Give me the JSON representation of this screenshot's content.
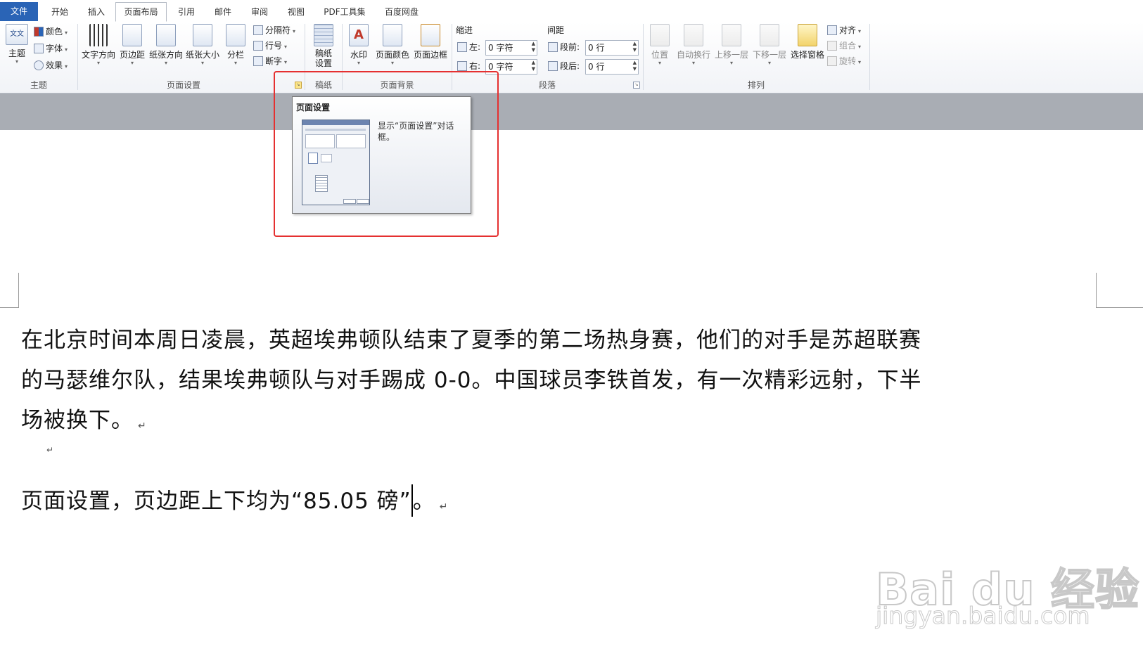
{
  "tabs": [
    {
      "label": "文件",
      "kind": "file"
    },
    {
      "label": "开始"
    },
    {
      "label": "插入"
    },
    {
      "label": "页面布局",
      "active": true
    },
    {
      "label": "引用"
    },
    {
      "label": "邮件"
    },
    {
      "label": "审阅"
    },
    {
      "label": "视图"
    },
    {
      "label": "PDF工具集"
    },
    {
      "label": "百度网盘"
    }
  ],
  "ribbon": {
    "theme_group": {
      "label": "主题",
      "theme_button": "主题",
      "theme_icon_text": "文文",
      "colors": "颜色",
      "fonts": "字体",
      "effects": "效果"
    },
    "page_setup_group": {
      "label": "页面设置",
      "text_direction": "文字方向",
      "margins": "页边距",
      "orientation": "纸张方向",
      "size": "纸张大小",
      "columns": "分栏",
      "breaks": "分隔符",
      "line_numbers": "行号",
      "hyphenation": "断字"
    },
    "manuscript_group": {
      "label": "稿纸",
      "manuscript_button": "稿纸\n设置"
    },
    "page_background_group": {
      "label": "页面背景",
      "watermark": "水印",
      "page_color": "页面颜色",
      "page_borders": "页面边框"
    },
    "paragraph_group": {
      "label": "段落",
      "indent_header": "缩进",
      "spacing_header": "间距",
      "indent_left_label": "左:",
      "indent_left_value": "0 字符",
      "indent_right_label": "右:",
      "indent_right_value": "0 字符",
      "spacing_before_label": "段前:",
      "spacing_before_value": "0 行",
      "spacing_after_label": "段后:",
      "spacing_after_value": "0 行"
    },
    "arrange_group": {
      "label": "排列",
      "position": "位置",
      "wrap_text": "自动换行",
      "bring_forward": "上移一层",
      "send_backward": "下移一层",
      "selection_pane": "选择窗格",
      "align": "对齐",
      "group": "组合",
      "rotate": "旋转"
    }
  },
  "tooltip": {
    "title": "页面设置",
    "description": "显示“页面设置”对话框。"
  },
  "document": {
    "paragraph1_line1": "在北京时间本周日凌晨，英超埃弗顿队结束了夏季的第二场热身赛，他们的对手是苏超联赛",
    "paragraph1_line2": "的马瑟维尔队，结果埃弗顿队与对手踢成 0-0。中国球员李铁首发，有一次精彩远射，下半",
    "paragraph1_line3": "场被换下。",
    "paragraph2": "页面设置，页边距上下均为“85.05 磅”",
    "paragraph2_end": "。",
    "paragraph_mark": "↵"
  },
  "watermark": {
    "logo_text": "Bai du 经验",
    "url": "jingyan.baidu.com"
  },
  "colors": {
    "file_tab": "#2a64b6",
    "highlight_box": "#e53030",
    "gray_gap": "#a9adb4"
  }
}
